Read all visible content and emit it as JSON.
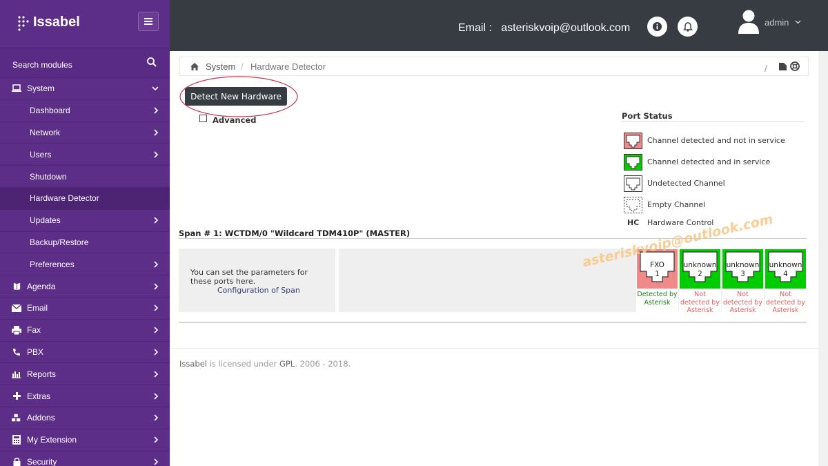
{
  "brand": {
    "name": "Issabel"
  },
  "sidebar": {
    "search_label": "Search modules",
    "system": {
      "label": "System"
    },
    "subitems": [
      {
        "label": "Dashboard",
        "chevron": true
      },
      {
        "label": "Network",
        "chevron": true
      },
      {
        "label": "Users",
        "chevron": true
      },
      {
        "label": "Shutdown",
        "chevron": false
      },
      {
        "label": "Hardware Detector",
        "chevron": false,
        "active": true
      },
      {
        "label": "Updates",
        "chevron": true
      },
      {
        "label": "Backup/Restore",
        "chevron": false
      },
      {
        "label": "Preferences",
        "chevron": true
      }
    ],
    "modules": [
      {
        "label": "Agenda",
        "icon": "book-icon"
      },
      {
        "label": "Email",
        "icon": "envelope-icon"
      },
      {
        "label": "Fax",
        "icon": "printer-icon"
      },
      {
        "label": "PBX",
        "icon": "phone-icon"
      },
      {
        "label": "Reports",
        "icon": "bar-chart-icon"
      },
      {
        "label": "Extras",
        "icon": "plus-icon"
      },
      {
        "label": "Addons",
        "icon": "cubes-icon"
      },
      {
        "label": "My Extension",
        "icon": "calculator-icon"
      },
      {
        "label": "Security",
        "icon": "lock-icon"
      }
    ]
  },
  "header": {
    "email_label": "Email :",
    "email_value": "asteriskvoip@outlook.com",
    "user": "admin"
  },
  "breadcrumb": {
    "root": "System",
    "separator": "/",
    "current": "Hardware Detector",
    "tools_separator": "/"
  },
  "actions": {
    "detect_label": "Detect New Hardware",
    "advanced_label": "Advanced"
  },
  "port_status": {
    "title": "Port Status",
    "legend": [
      {
        "label": "Channel detected and not in service",
        "color": "#f08a8a",
        "style": "solid"
      },
      {
        "label": "Channel detected and in service",
        "color": "#00cc00",
        "style": "solid"
      },
      {
        "label": "Undetected Channel",
        "color": "#ffffff",
        "style": "solid"
      },
      {
        "label": "Empty Channel",
        "color": "#ffffff",
        "style": "dotted"
      }
    ],
    "hc_abbr": "HC",
    "hc_label": "Hardware Control"
  },
  "span": {
    "title": "Span # 1: WCTDM/0 \"Wildcard TDM410P\" (MASTER)",
    "info_text": "You can set the parameters for these ports here.",
    "config_link": "Configuration of Span",
    "ports": [
      {
        "type": "FXO",
        "number": "1",
        "color": "#f08a8a",
        "status": "Detected by Asterisk",
        "status_color": "#1a7a1a"
      },
      {
        "type": "unknown",
        "number": "2",
        "color": "#00cc00",
        "status": "Not detected by Asterisk",
        "status_color": "#e06060"
      },
      {
        "type": "unknown",
        "number": "3",
        "color": "#00cc00",
        "status": "Not detected by Asterisk",
        "status_color": "#e06060"
      },
      {
        "type": "unknown",
        "number": "4",
        "color": "#00cc00",
        "status": "Not detected by Asterisk",
        "status_color": "#e06060"
      }
    ]
  },
  "watermark": "asteriskvoip@outlook.com",
  "footer": {
    "brand": "Issabel",
    "text1": " is licensed under ",
    "license": "GPL",
    "text2": ". 2006 - 2018."
  }
}
